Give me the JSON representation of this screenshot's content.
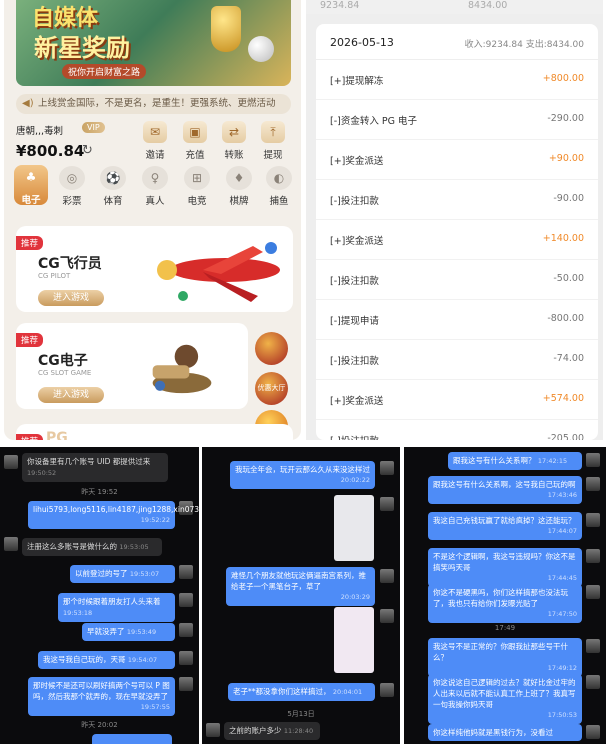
{
  "game": {
    "banner": {
      "line1": "自媒体",
      "line2": "新星奖励",
      "line3": "祝你开启财富之路"
    },
    "announcement": "上线赏金国际，不是更名，是重生！更强系统、更燃活动",
    "user": {
      "name": "唐朝,,,毒刺",
      "balance": "¥800.84"
    },
    "actions": [
      {
        "label": "邀请",
        "icon": "invite-icon"
      },
      {
        "label": "充值",
        "icon": "deposit-icon"
      },
      {
        "label": "转账",
        "icon": "transfer-icon"
      },
      {
        "label": "提现",
        "icon": "withdraw-icon"
      }
    ],
    "categories": [
      {
        "label": "电子",
        "icon": "slot-icon",
        "active": true
      },
      {
        "label": "彩票",
        "icon": "lottery-icon"
      },
      {
        "label": "体育",
        "icon": "sports-icon"
      },
      {
        "label": "真人",
        "icon": "live-icon"
      },
      {
        "label": "电竞",
        "icon": "esports-icon"
      },
      {
        "label": "棋牌",
        "icon": "cards-icon"
      },
      {
        "label": "捕鱼",
        "icon": "fishing-icon"
      }
    ],
    "cards": [
      {
        "tag": "推荐",
        "name": "CG飞行员",
        "sub": "CG PILOT",
        "button": "进入游戏"
      },
      {
        "tag": "推荐",
        "name": "CG电子",
        "sub": "CG SLOT GAME",
        "button": "进入游戏"
      },
      {
        "tag": "推荐",
        "name": "PG"
      }
    ],
    "side_labels": [
      "优惠大厅"
    ]
  },
  "ledger": {
    "top": [
      "9234.84",
      "8434.00"
    ],
    "date": "2026-05-13",
    "summary": "收入:9234.84  支出:8434.00",
    "rows": [
      {
        "desc": "[+]提现解冻",
        "amount": "+800.00",
        "type": "pos"
      },
      {
        "desc": "[-]资金转入 PG 电子",
        "amount": "-290.00",
        "type": "neg"
      },
      {
        "desc": "[+]奖金派送",
        "amount": "+90.00",
        "type": "pos"
      },
      {
        "desc": "[-]投注扣款",
        "amount": "-90.00",
        "type": "neg"
      },
      {
        "desc": "[+]奖金派送",
        "amount": "+140.00",
        "type": "pos"
      },
      {
        "desc": "[-]投注扣款",
        "amount": "-50.00",
        "type": "neg"
      },
      {
        "desc": "[-]提现申请",
        "amount": "-800.00",
        "type": "neg"
      },
      {
        "desc": "[-]投注扣款",
        "amount": "-74.00",
        "type": "neg"
      },
      {
        "desc": "[+]奖金派送",
        "amount": "+574.00",
        "type": "pos"
      },
      {
        "desc": "[-]投注扣款",
        "amount": "-205.00",
        "type": "neg"
      }
    ]
  },
  "chat1": {
    "m1": "你设备里有几个账号 UID 都提供过来",
    "t1": "19:50:52",
    "day1": "昨天 19:52",
    "m2": "lihui5793,long5116,lin4187,jing1288,xin07309",
    "t2": "19:52:22",
    "m3": "注册这么多账号是做什么的",
    "t3": "19:53:05",
    "m4": "以前登过的号了",
    "t4": "19:53:07",
    "m5": "那个时候跟着朋友打人头来着",
    "t5": "19:53:18",
    "m6": "早就没弄了",
    "t6": "19:53:49",
    "m7": "我这号我自己玩的，天哥",
    "t7": "19:54:07",
    "m8": "那时候不是还可以刷好搞两个号可以 P 图吗，然后我那个就弄的，现在早就没弄了",
    "t8": "19:57:55",
    "day2": "昨天 20:02"
  },
  "chat2": {
    "m1": "我玩全年会，玩开云那么久从来没这样过",
    "t1": "20:02:22",
    "m2": "难怪几个朋友就他玩这俩逼南宫系列，推给老子一个黑笔台子，草了",
    "t2": "20:03:29",
    "m3": "老子**都没拿你们这样搞过，",
    "t3": "20:04:01",
    "day": "5月13日",
    "m4": "之前的账户多少",
    "t4": "11:28:40"
  },
  "chat3": {
    "m1": "跟我这号有什么关系啊？",
    "t1": "17:42:15",
    "m2": "跟我这号有什么关系啊，这号我自己玩的啊",
    "t2": "17:43:46",
    "m3": "我这自己充钱玩赢了就给疯掉？这还能玩？",
    "t3": "17:44:07",
    "m4": "不是这个逻辑啊，我这号违规吗？你这不是搞笑吗天哥",
    "t4": "17:44:45",
    "m5": "你这不是硬黑吗，你们这样搞那也没法玩了，我也只有给你们发曝光贴了",
    "t5": "17:47:50",
    "day": "17:49",
    "m6": "我这号不是正常的？你跟我扯那些号干什么？",
    "t6": "17:49:12",
    "m7": "你这说这自己逻辑的过去？就好比金过牢的人出来以后就不能认真工作上班了？我真写一句我操你妈天哥",
    "t7": "17:50:53",
    "m8": "你这样纯他妈就是黑钱行为，没看过"
  }
}
